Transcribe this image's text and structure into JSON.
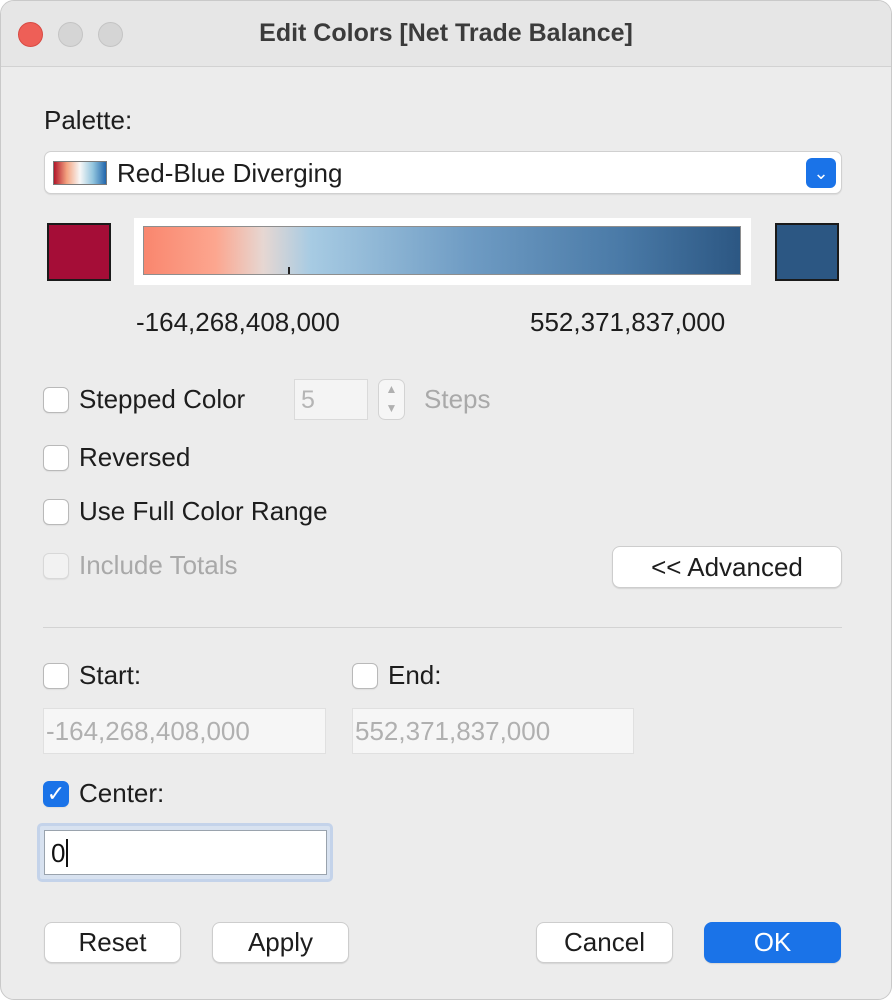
{
  "window": {
    "title": "Edit Colors [Net Trade Balance]"
  },
  "palette": {
    "label": "Palette:",
    "selected": "Red-Blue Diverging",
    "start_color": "#a50d37",
    "end_color": "#2c5783",
    "ramp_colors": [
      "#f9866e",
      "#fca68f",
      "#e6d7d2",
      "#a7cbe3",
      "#6e9bc3",
      "#4a7aa7",
      "#2c5783"
    ]
  },
  "range": {
    "min_label": "-164,268,408,000",
    "max_label": "552,371,837,000"
  },
  "options": {
    "stepped_color": {
      "label": "Stepped Color",
      "checked": false,
      "steps_value": "5",
      "steps_label": "Steps"
    },
    "reversed": {
      "label": "Reversed",
      "checked": false
    },
    "use_full_range": {
      "label": "Use Full Color Range",
      "checked": false
    },
    "include_totals": {
      "label": "Include Totals",
      "checked": false,
      "disabled": true
    },
    "advanced_button": "<< Advanced"
  },
  "advanced": {
    "start": {
      "label": "Start:",
      "checked": false,
      "value": "-164,268,408,000"
    },
    "end": {
      "label": "End:",
      "checked": false,
      "value": "552,371,837,000"
    },
    "center": {
      "label": "Center:",
      "checked": true,
      "value": "0"
    }
  },
  "buttons": {
    "reset": "Reset",
    "apply": "Apply",
    "cancel": "Cancel",
    "ok": "OK"
  },
  "accent_color": "#1a73e8"
}
